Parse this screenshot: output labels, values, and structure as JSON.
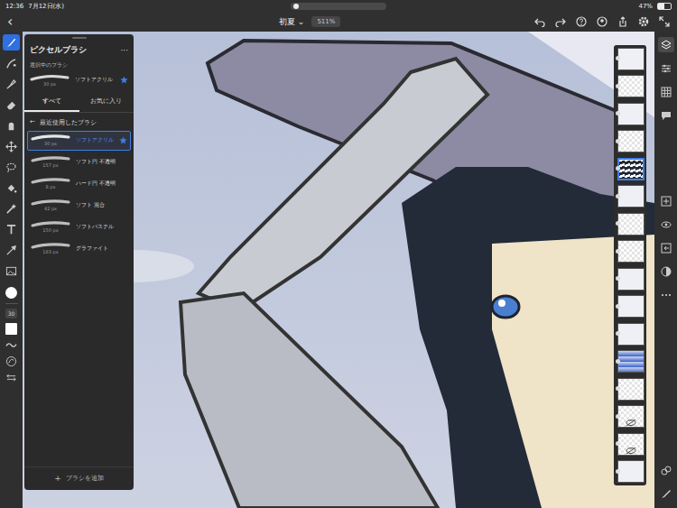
{
  "status_bar": {
    "time": "12:36",
    "date": "7月12日(水)",
    "battery": "47%",
    "battery_level": 0.47
  },
  "top_bar": {
    "back": "‹",
    "title": "初夏",
    "title_menu": "⌄",
    "zoom": "511%"
  },
  "tools": [
    {
      "kind": "brush",
      "selected": true
    },
    {
      "kind": "live",
      "selected": false
    },
    {
      "kind": "vector",
      "selected": false
    },
    {
      "kind": "eraser",
      "selected": false
    },
    {
      "kind": "smudge",
      "selected": false
    },
    {
      "kind": "move",
      "selected": false
    },
    {
      "kind": "lasso",
      "selected": false
    },
    {
      "kind": "fill",
      "selected": false
    },
    {
      "kind": "magic",
      "selected": false
    },
    {
      "kind": "text",
      "selected": false
    },
    {
      "kind": "eyedropper",
      "selected": false
    },
    {
      "kind": "image",
      "selected": false
    }
  ],
  "current_color": "#ffffff",
  "brush_size": "30",
  "brush_panel": {
    "title": "ピクセルブラシ",
    "more": "···",
    "current_label": "選択中のブラシ",
    "current": {
      "name": "ソフトアクリル",
      "size": "30 px",
      "favorite": true
    },
    "tabs": [
      {
        "label": "すべて",
        "selected": true
      },
      {
        "label": "お気に入り",
        "selected": false
      }
    ],
    "back": "←",
    "section": "最近使用したブラシ",
    "brushes": [
      {
        "name": "ソフトアクリル",
        "size": "30 px",
        "selected": true,
        "favorite": true
      },
      {
        "name": "ソフト円 不透明",
        "size": "157 px",
        "selected": false,
        "favorite": false
      },
      {
        "name": "ハード円 不透明",
        "size": "8 px",
        "selected": false,
        "favorite": false
      },
      {
        "name": "ソフト 混合",
        "size": "42 px",
        "selected": false,
        "favorite": false
      },
      {
        "name": "ソフトパステル",
        "size": "150 px",
        "selected": false,
        "favorite": false
      },
      {
        "name": "グラファイト",
        "size": "183 px",
        "selected": false,
        "favorite": false
      }
    ],
    "add": {
      "icon": "+",
      "label": "ブラシを追加"
    }
  },
  "layers": [
    {
      "kind": "light",
      "selected": false,
      "visible": true
    },
    {
      "kind": "transparent",
      "selected": false,
      "visible": true
    },
    {
      "kind": "light",
      "selected": false,
      "visible": true
    },
    {
      "kind": "transparent",
      "selected": false,
      "visible": true
    },
    {
      "kind": "dark",
      "selected": true,
      "visible": true
    },
    {
      "kind": "light",
      "selected": false,
      "visible": true
    },
    {
      "kind": "transparent",
      "selected": false,
      "visible": true
    },
    {
      "kind": "transparent",
      "selected": false,
      "visible": true
    },
    {
      "kind": "light",
      "selected": false,
      "visible": true
    },
    {
      "kind": "light",
      "selected": false,
      "visible": true
    },
    {
      "kind": "light",
      "selected": false,
      "visible": true
    },
    {
      "kind": "gradient",
      "selected": false,
      "visible": true
    },
    {
      "kind": "transparent",
      "selected": false,
      "visible": true
    },
    {
      "kind": "transparent",
      "selected": false,
      "visible": false
    },
    {
      "kind": "transparent",
      "selected": false,
      "visible": false
    },
    {
      "kind": "light",
      "selected": false,
      "visible": true
    }
  ]
}
